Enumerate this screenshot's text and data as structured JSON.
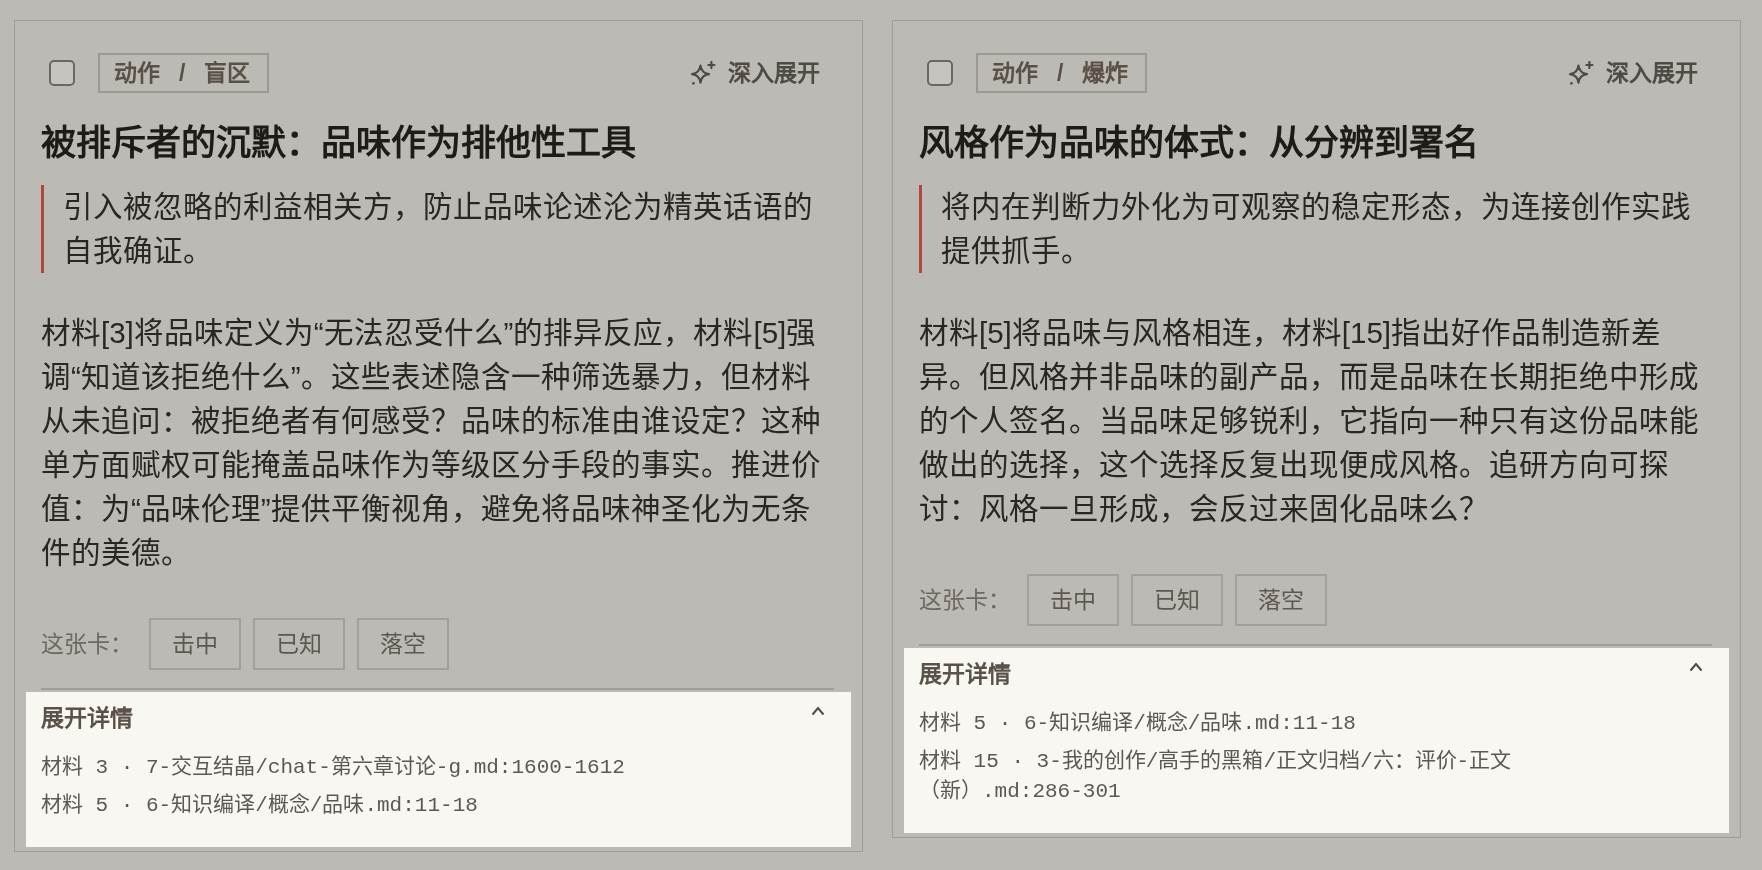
{
  "cards": [
    {
      "checked": false,
      "tag": "动作 / 盲区",
      "expand_button": "深入展开",
      "title": "被排斥者的沉默：品味作为排他性工具",
      "summary": "引入被忽略的利益相关方，防止品味论述沦为精英话语的自我确证。",
      "body": "材料[3]将品味定义为“无法忍受什么”的排异反应，材料[5]强调“知道该拒绝什么”。这些表述隐含一种筛选暴力，但材料从未追问：被拒绝者有何感受？品味的标准由谁设定？这种单方面赋权可能掩盖品味作为等级区分手段的事实。推进价值：为“品味伦理”提供平衡视角，避免将品味神圣化为无条件的美德。",
      "feedback": {
        "label": "这张卡：",
        "buttons": [
          {
            "label": "击中",
            "selected": false
          },
          {
            "label": "已知",
            "selected": false
          },
          {
            "label": "落空",
            "selected": false
          }
        ]
      },
      "details": {
        "title": "展开详情",
        "expanded": true,
        "sources": [
          "材料 3 · 7-交互结晶/chat-第六章讨论-g.md:1600-1612",
          "材料 5 · 6-知识编译/概念/品味.md:11-18"
        ]
      }
    },
    {
      "checked": false,
      "tag": "动作 / 爆炸",
      "expand_button": "深入展开",
      "title": "风格作为品味的体式：从分辨到署名",
      "summary": "将内在判断力外化为可观察的稳定形态，为连接创作实践提供抓手。",
      "body": "材料[5]将品味与风格相连，材料[15]指出好作品制造新差异。但风格并非品味的副产品，而是品味在长期拒绝中形成的个人签名。当品味足够锐利，它指向一种只有这份品味能做出的选择，这个选择反复出现便成风格。追研方向可探讨：风格一旦形成，会反过来固化品味么？",
      "feedback": {
        "label": "这张卡：",
        "buttons": [
          {
            "label": "击中",
            "selected": false
          },
          {
            "label": "已知",
            "selected": false
          },
          {
            "label": "落空",
            "selected": false
          }
        ]
      },
      "details": {
        "title": "展开详情",
        "expanded": true,
        "sources": [
          "材料 5 · 6-知识编译/概念/品味.md:11-18",
          "材料 15 · 3-我的创作/高手的黑箱/正文归档/六：评价-正文（新）.md:286-301"
        ]
      }
    }
  ]
}
